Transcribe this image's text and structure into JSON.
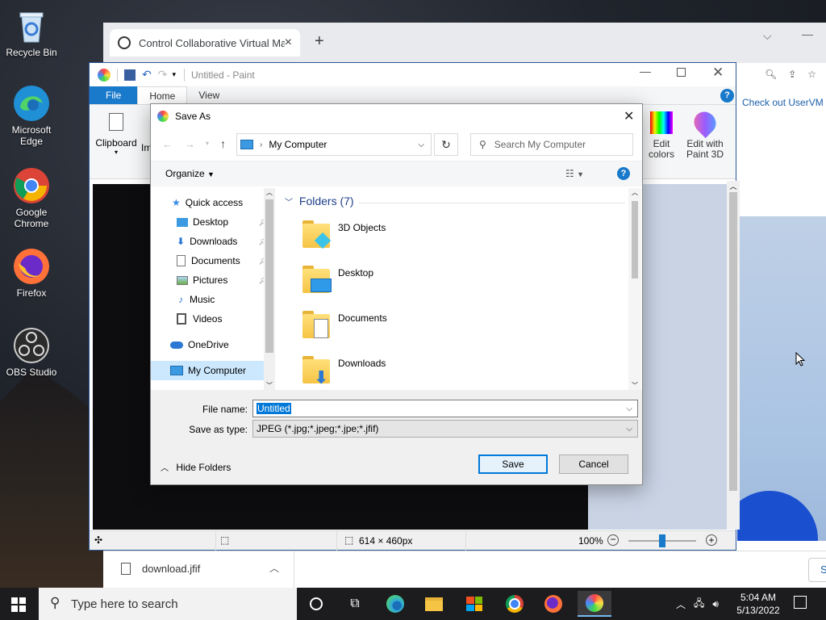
{
  "desktop": {
    "icons": [
      {
        "label": "Recycle Bin"
      },
      {
        "label": "Microsoft Edge"
      },
      {
        "label": "Google Chrome"
      },
      {
        "label": "Firefox"
      },
      {
        "label": "OBS Studio"
      }
    ]
  },
  "browser": {
    "tab_title": "Control Collaborative Virtual Ma",
    "tab_close": "×",
    "new_tab": "+",
    "page_snippet": "Check out UserVM fo",
    "download_file": "download.jfif",
    "right_button": "S"
  },
  "paint": {
    "title": "Untitled - Paint",
    "tabs": [
      "File",
      "Home",
      "View"
    ],
    "ribbon": {
      "clipboard": "Clipboard",
      "image_partial": "Im",
      "edit_colors": "Edit colors",
      "edit_paint3d": "Edit with Paint 3D"
    },
    "status": {
      "dimensions": "614 × 460px",
      "zoom": "100%"
    },
    "help": "?"
  },
  "dialog": {
    "title": "Save As",
    "address": "My Computer",
    "search_placeholder": "Search My Computer",
    "organize": "Organize",
    "help": "?",
    "nav": {
      "quick_access": "Quick access",
      "items": [
        "Desktop",
        "Downloads",
        "Documents",
        "Pictures",
        "Music",
        "Videos"
      ],
      "onedrive": "OneDrive",
      "my_computer": "My Computer"
    },
    "folders_header": "Folders (7)",
    "folders": [
      "3D Objects",
      "Desktop",
      "Documents",
      "Downloads"
    ],
    "file_name_label": "File name:",
    "file_name_value": "Untitled",
    "save_type_label": "Save as type:",
    "save_type_value": "JPEG (*.jpg;*.jpeg;*.jpe;*.jfif)",
    "hide_folders": "Hide Folders",
    "save": "Save",
    "cancel": "Cancel"
  },
  "taskbar": {
    "search_placeholder": "Type here to search",
    "time": "5:04 AM",
    "date": "5/13/2022"
  }
}
